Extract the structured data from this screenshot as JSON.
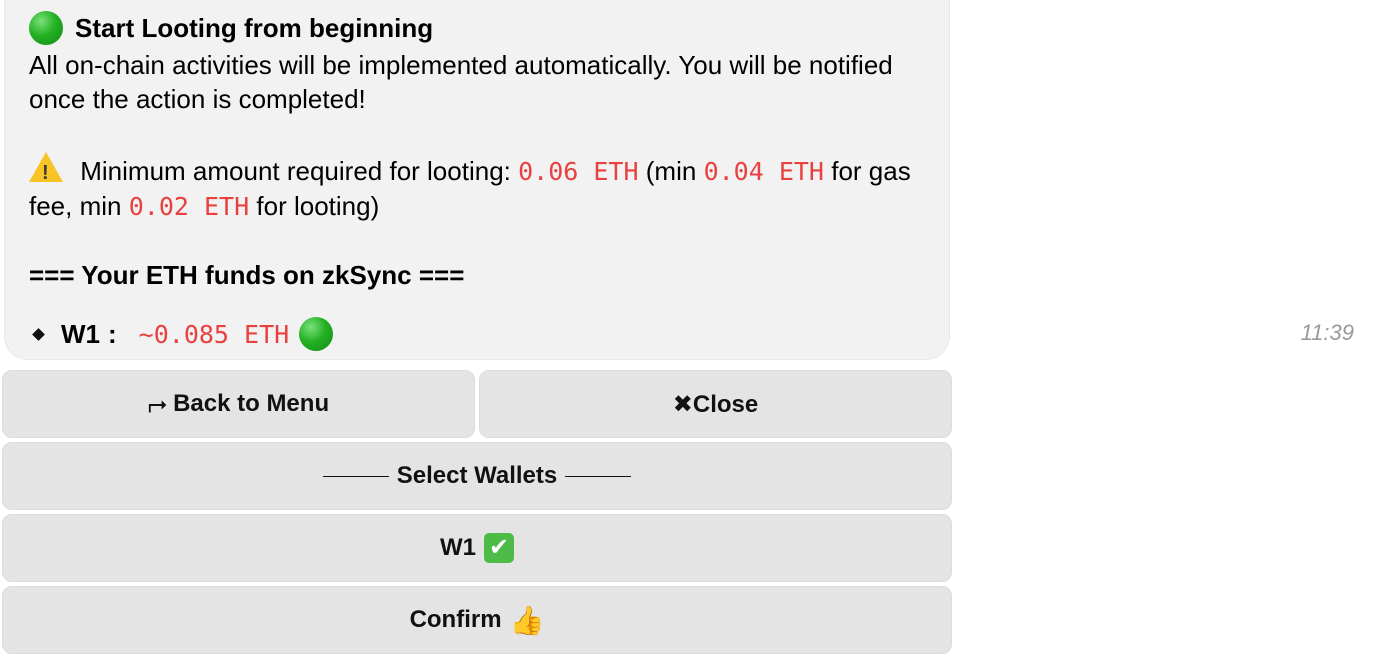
{
  "message": {
    "title": "Start Looting from beginning",
    "intro": "All on-chain activities will be implemented automatically. You will be notified once the action is completed!",
    "min_label": "Minimum amount required for looting:",
    "min_total": "0.06 ETH",
    "min_open": "(min",
    "min_gas": "0.04 ETH",
    "gas_text": "for gas fee, min",
    "min_loot": "0.02 ETH",
    "loot_text": "for looting)",
    "funds_header": "=== Your ETH funds on zkSync ===",
    "wallet_name": "W1",
    "wallet_sep": ":",
    "wallet_amount": "~0.085 ETH",
    "time": "11:39"
  },
  "keyboard": {
    "back_arrow": "⮣",
    "back_label": "Back to Menu",
    "close_label": "✖Close",
    "select_label": "Select Wallets",
    "wallet_label": "W1",
    "wallet_check": "✔",
    "confirm_label": "Confirm",
    "confirm_emoji": "👍"
  },
  "colors": {
    "amount": "#e8413f",
    "green_dot": "#24b124",
    "bubble_bg": "#f2f2f2",
    "button_bg": "#e4e4e4"
  }
}
